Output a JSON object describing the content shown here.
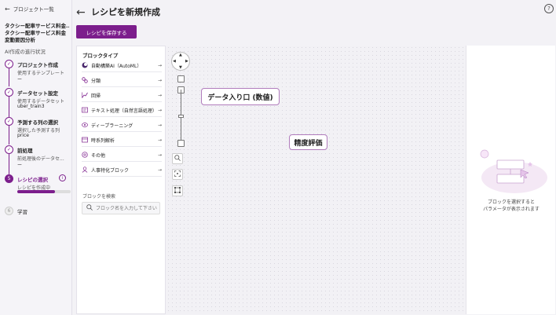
{
  "sidebar": {
    "back_label": "プロジェクト一覧",
    "project_name": "タクシー配車サービス料金...",
    "project_sub": "タクシー配車サービス料金変動要因分析",
    "ai_status": "AI作成の進行状況",
    "steps": [
      {
        "title": "プロジェクト作成",
        "desc": "使用するテンプレート",
        "value": "ー"
      },
      {
        "title": "データセット設定",
        "desc": "使用するデータセット",
        "value": "uber_train3"
      },
      {
        "title": "予測する列の選択",
        "desc": "選択した予測する列",
        "value": "price"
      },
      {
        "title": "前処理",
        "desc": "前処理後のデータセ...",
        "value": "ー"
      },
      {
        "number": "5",
        "title": "レシピの選択",
        "desc": "レシピを作成中",
        "progress": 0.7
      },
      {
        "number": "6",
        "title": "学習"
      }
    ]
  },
  "header": {
    "title": "レシピを新規作成",
    "save_label": "レシピを保存する",
    "help_glyph": "?"
  },
  "block_panel": {
    "heading": "ブロックタイプ",
    "items": [
      {
        "label": "自動構築AI（AutoML）",
        "icon": "automl-icon"
      },
      {
        "label": "分類",
        "icon": "classification-icon"
      },
      {
        "label": "回帰",
        "icon": "regression-icon"
      },
      {
        "label": "テキスト処理（自然言語処理）",
        "icon": "text-processing-icon"
      },
      {
        "label": "ディープラーニング",
        "icon": "deep-learning-icon"
      },
      {
        "label": "時系列解析",
        "icon": "time-series-icon"
      },
      {
        "label": "その他",
        "icon": "other-icon"
      },
      {
        "label": "人事特化ブロック",
        "icon": "hr-block-icon"
      }
    ],
    "search_heading": "ブロックを検索",
    "search_placeholder": "ブロック名を入力して下さい"
  },
  "canvas": {
    "nodes": [
      {
        "label": "データ入り口 (数値)"
      },
      {
        "label": "精度評価"
      }
    ]
  },
  "param_panel": {
    "message_line1": "ブロックを選択すると",
    "message_line2": "パラメータが表示されます"
  },
  "colors": {
    "accent": "#7c1e8c",
    "node_border": "#b07cbc"
  }
}
